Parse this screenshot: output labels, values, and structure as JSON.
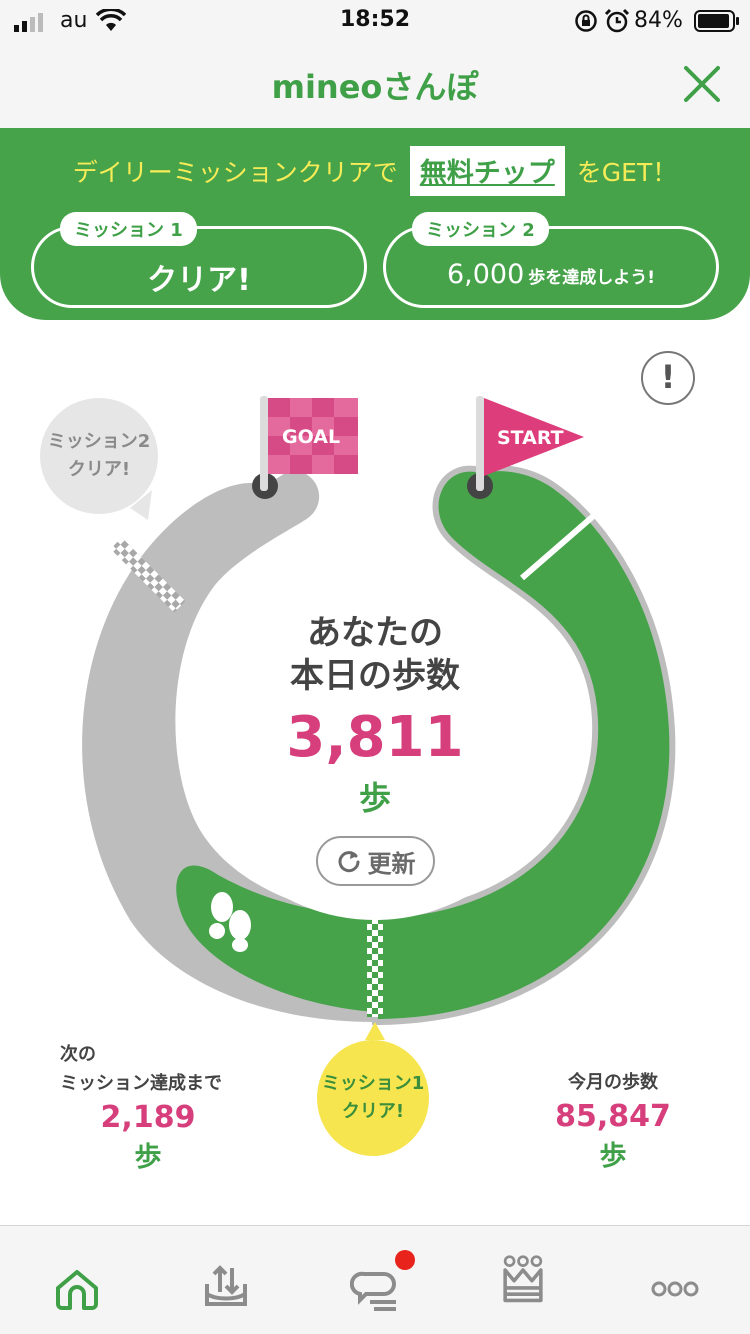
{
  "status_bar": {
    "carrier": "au",
    "time": "18:52",
    "battery_percent": "84%",
    "icons": [
      "signal-icon",
      "wifi-icon",
      "rotation-lock-icon",
      "alarm-icon",
      "battery-icon"
    ]
  },
  "navbar": {
    "title": "mineoさんぽ",
    "close_icon": "close-icon"
  },
  "banner": {
    "headline_before": "デイリーミッションクリアで",
    "tip_label": "無料チップ",
    "headline_after": "をGET！",
    "missions": [
      {
        "tag": "ミッション 1",
        "status": "クリア!"
      },
      {
        "tag": "ミッション 2",
        "goal_number": "6,000",
        "goal_text": "歩を達成しよう!"
      }
    ]
  },
  "course": {
    "goal_flag": "GOAL",
    "start_flag": "START",
    "bubble_mission2": [
      "ミッション2",
      "クリア!"
    ],
    "bubble_mission1": [
      "ミッション1",
      "クリア!"
    ],
    "center_label": [
      "あなたの",
      "本日の歩数"
    ],
    "today_steps": "3,811",
    "steps_unit": "歩",
    "refresh_label": "更新",
    "progress_fraction": 0.55,
    "colors": {
      "done": "#46a34a",
      "remaining": "#bdbdbd",
      "accent_pink": "#d63f7c",
      "bubble_yellow": "#f6e54e"
    }
  },
  "stats": {
    "next": {
      "label": [
        "次の",
        "ミッション達成まで"
      ],
      "value": "2,189",
      "unit": "歩"
    },
    "month": {
      "label": "今月の歩数",
      "value": "85,847",
      "unit": "歩"
    }
  },
  "tabbar": {
    "tabs": [
      "home-icon",
      "upload-icon",
      "chat-icon",
      "ranking-icon",
      "more-icon"
    ],
    "active": "home-icon"
  }
}
